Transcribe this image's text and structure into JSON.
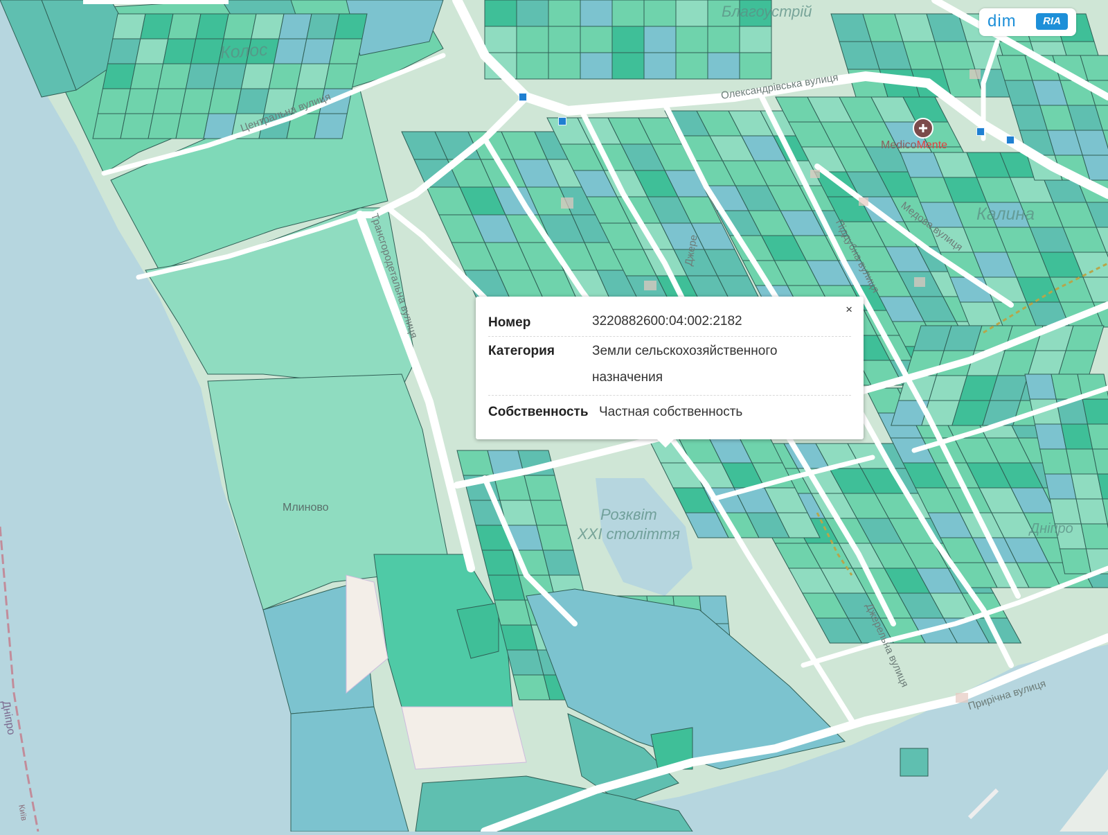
{
  "brand": {
    "dim": "dim",
    "ria": "RIA"
  },
  "map": {
    "colors": {
      "water": "#b6d6df",
      "land": "#cfe6d6",
      "road": "#ffffff",
      "parcel_green": "#6fd3ac",
      "parcel_teal": "#5fbfb0",
      "parcel_blue": "#7cc3cf",
      "parcel_dark": "#3fbf98",
      "parcel_light": "#8fdcc0",
      "border": "#2f5f55"
    },
    "streets": {
      "oleksandrivska": "Олександрівська вулиця",
      "tsentralna": "Центральна вулиця",
      "hranichna": "Трансгородетальна вулиця",
      "medova": "Медова вулиця",
      "piddubna": "Піддубна вулиця",
      "dzherelna1": "Джере",
      "dzherelna2": "Джерельна вулиця",
      "prurichna": "Прирічна вулиця"
    },
    "areas": {
      "kolos": "Колос",
      "blahoustrii": "Благоустрій",
      "kalyna": "Калина",
      "mlynovo": "Млиново",
      "rozkvit": "Розквіт",
      "xxi": "XXI століття",
      "dnipro_east": "Дніпро",
      "dnipro_river": "Дніпро",
      "kyiv": "Київ"
    },
    "poi": {
      "clinic_a": "Medico",
      "clinic_b": "Mente"
    }
  },
  "popup": {
    "close_label": "×",
    "rows": [
      {
        "key": "Номер",
        "value": "3220882600:04:002:2182"
      },
      {
        "key": "Категория",
        "value": "Земли сельскохозяйственного назначения"
      },
      {
        "key": "Собственность",
        "value": "Частная собственность"
      }
    ]
  }
}
